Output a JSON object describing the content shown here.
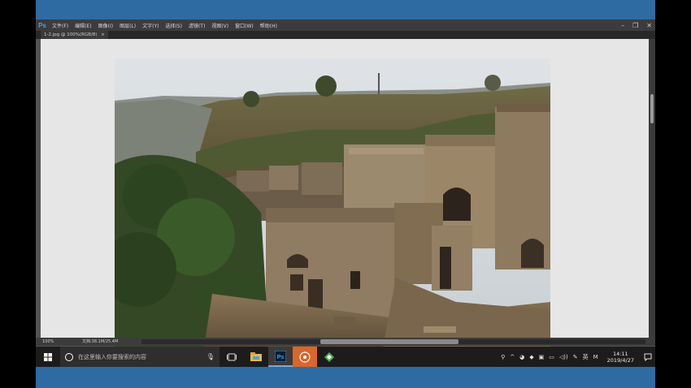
{
  "photoshop": {
    "logo": "Ps",
    "menu": [
      "文件(F)",
      "编辑(E)",
      "图像(I)",
      "图层(L)",
      "文字(Y)",
      "选择(S)",
      "滤镜(T)",
      "视图(V)",
      "窗口(W)",
      "帮助(H)"
    ],
    "window_controls": [
      "–",
      "❐",
      "✕"
    ],
    "tab_label": "1-2.jpg @ 100%(RGB/8)",
    "tab_close": "×",
    "status_zoom": "100%",
    "status_doc": "文档:38.1M/25.4M"
  },
  "taskbar": {
    "search_placeholder": "在这里输入你要搜索的内容",
    "tray": {
      "ime": "英",
      "ime2": "M",
      "time": "14:11",
      "date": "2019/4/27"
    }
  },
  "icons": {
    "start": "windows-icon",
    "cortana": "cortana-circle-icon",
    "mic": "microphone-icon",
    "task_view": "task-view-icon",
    "explorer": "file-explorer-icon",
    "photoshop": "photoshop-icon",
    "music": "music-player-icon",
    "app": "green-app-icon"
  },
  "colors": {
    "desktop_blue": "#2f6ba3",
    "ps_dark": "#3c3c3c",
    "canvas_bg": "#e6e6e6",
    "ps_blue": "#31a8ff"
  }
}
